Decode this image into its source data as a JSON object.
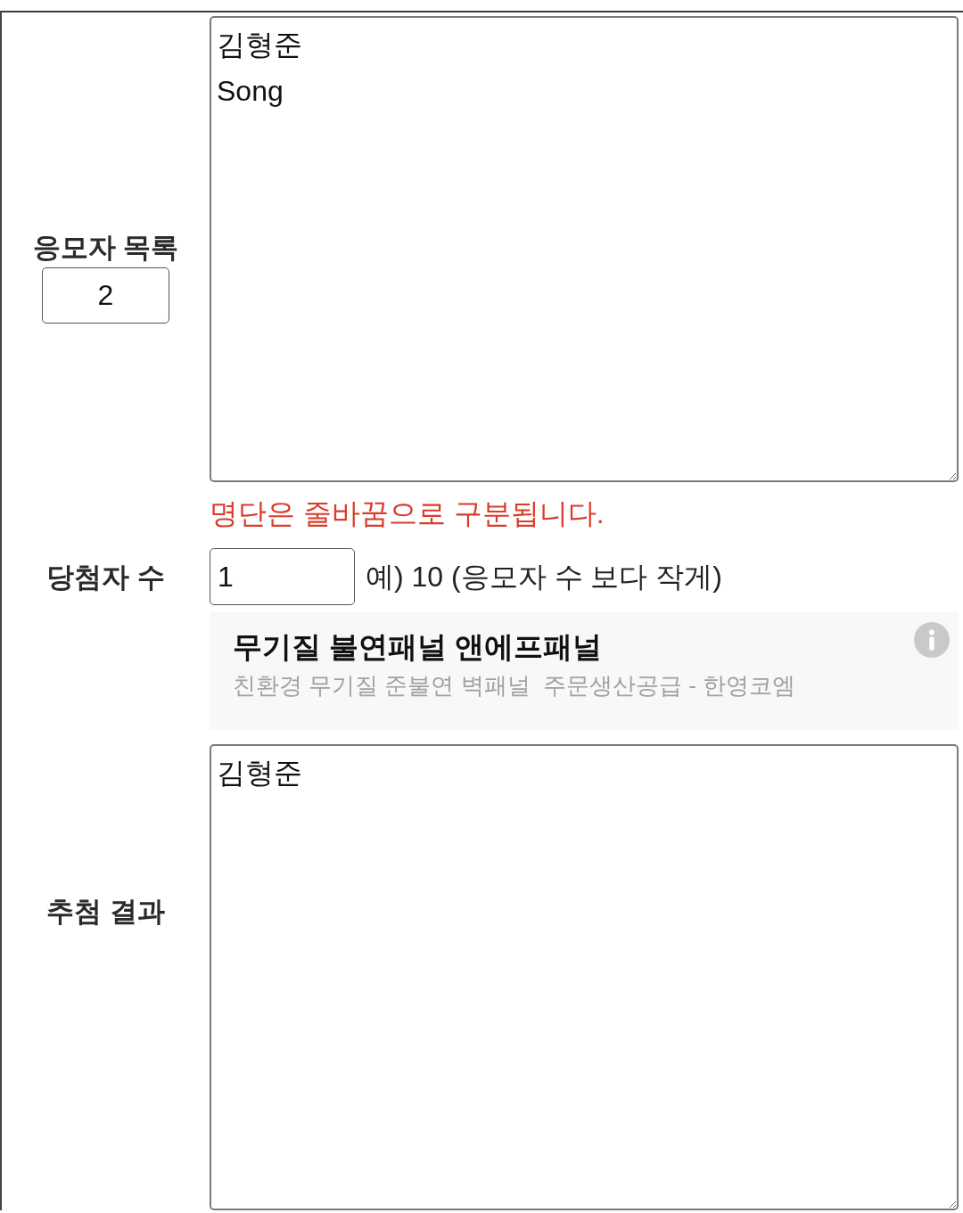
{
  "entrants": {
    "label": "응모자 목록",
    "count": "2",
    "names": [
      "김형준",
      "Song"
    ],
    "hint": "명단은 줄바꿈으로 구분됩니다."
  },
  "winners": {
    "label": "당첨자 수",
    "value": "1",
    "example": "예) 10 (응모자 수 보다 작게)"
  },
  "ad": {
    "title": "무기질 불연패널 앤에프패널",
    "subtitle": "친환경 무기질 준불연 벽패널  주문생산공급 - 한영코엠"
  },
  "result": {
    "label": "추첨 결과",
    "names": [
      "김형준"
    ]
  }
}
